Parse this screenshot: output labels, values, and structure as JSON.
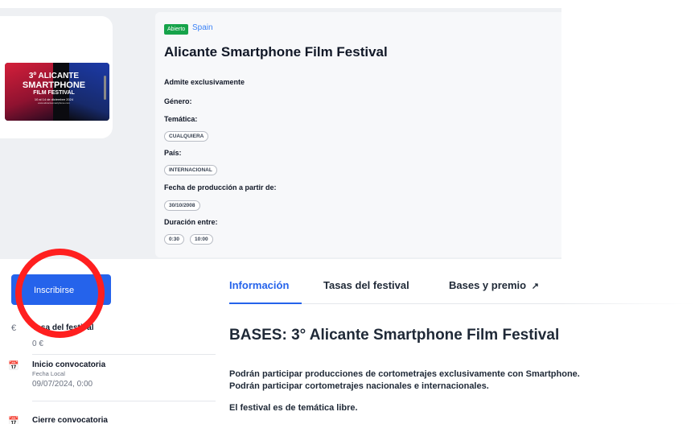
{
  "poster": {
    "line1": "3º ALICANTE",
    "line2": "SMARTPHONE",
    "line3": "FILM FESTIVAL",
    "line4": "10 al 14 de diciembre 2024",
    "line5": "www.alicantesmartphone.com"
  },
  "festival": {
    "status": "Abierto",
    "country": "Spain",
    "title": "Alicante Smartphone Film Festival",
    "admite_label": "Admite exclusivamente",
    "genero_label": "Género:",
    "tematica_label": "Temática:",
    "tematica_value": "CUALQUIERA",
    "pais_label": "País:",
    "pais_value": "INTERNACIONAL",
    "fecha_label": "Fecha de producción a partir de:",
    "fecha_value": "30/10/2008",
    "duracion_label": "Duración entre:",
    "duracion_min": "0:30",
    "duracion_max": "10:00"
  },
  "sidebar": {
    "register_label": "Inscribirse",
    "items": [
      {
        "icon": "€",
        "title": "Tasa del festival",
        "value": "0 €"
      },
      {
        "icon": "📅",
        "title": "Inicio convocatoria",
        "sub": "Fecha Local",
        "value": "09/07/2024, 0:00"
      },
      {
        "icon": "📅",
        "title": "Cierre convocatoria"
      }
    ]
  },
  "tabs": [
    {
      "label": "Información",
      "active": true
    },
    {
      "label": "Tasas del festival",
      "active": false
    },
    {
      "label": "Bases y premio",
      "active": false
    }
  ],
  "content": {
    "heading": "BASES: 3° Alicante Smartphone Film Festival",
    "p1": "Podrán participar producciones de cortometrajes exclusivamente con Smartphone.",
    "p2": "Podrán participar cortometrajes nacionales e internacionales.",
    "p3": "El festival es de temática libre."
  },
  "colors": {
    "accent": "#2563eb",
    "status_green": "#16a34a",
    "annotation_red": "#ff1f1f"
  }
}
